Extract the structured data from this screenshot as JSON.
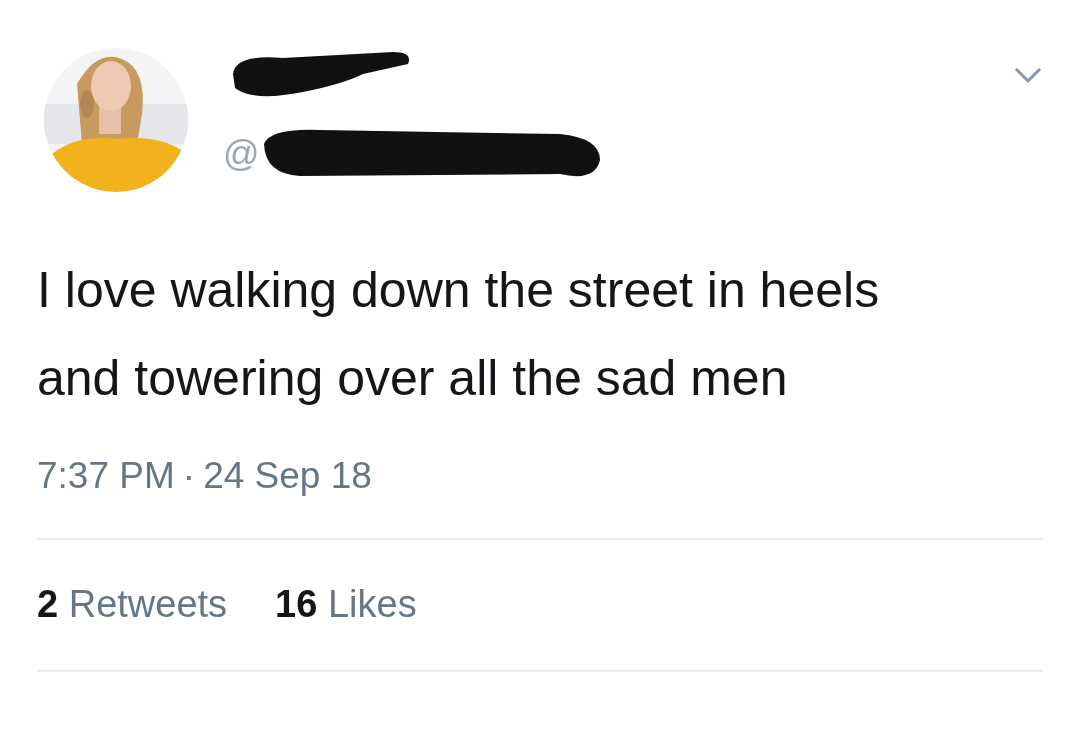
{
  "author": {
    "handle_prefix": "@"
  },
  "tweet": {
    "text": "I love walking down the street in heels and towering over all the sad men",
    "time": "7:37 PM",
    "separator": "·",
    "date": "24 Sep 18"
  },
  "stats": [
    {
      "count": "2",
      "label": "Retweets"
    },
    {
      "count": "16",
      "label": "Likes"
    }
  ]
}
